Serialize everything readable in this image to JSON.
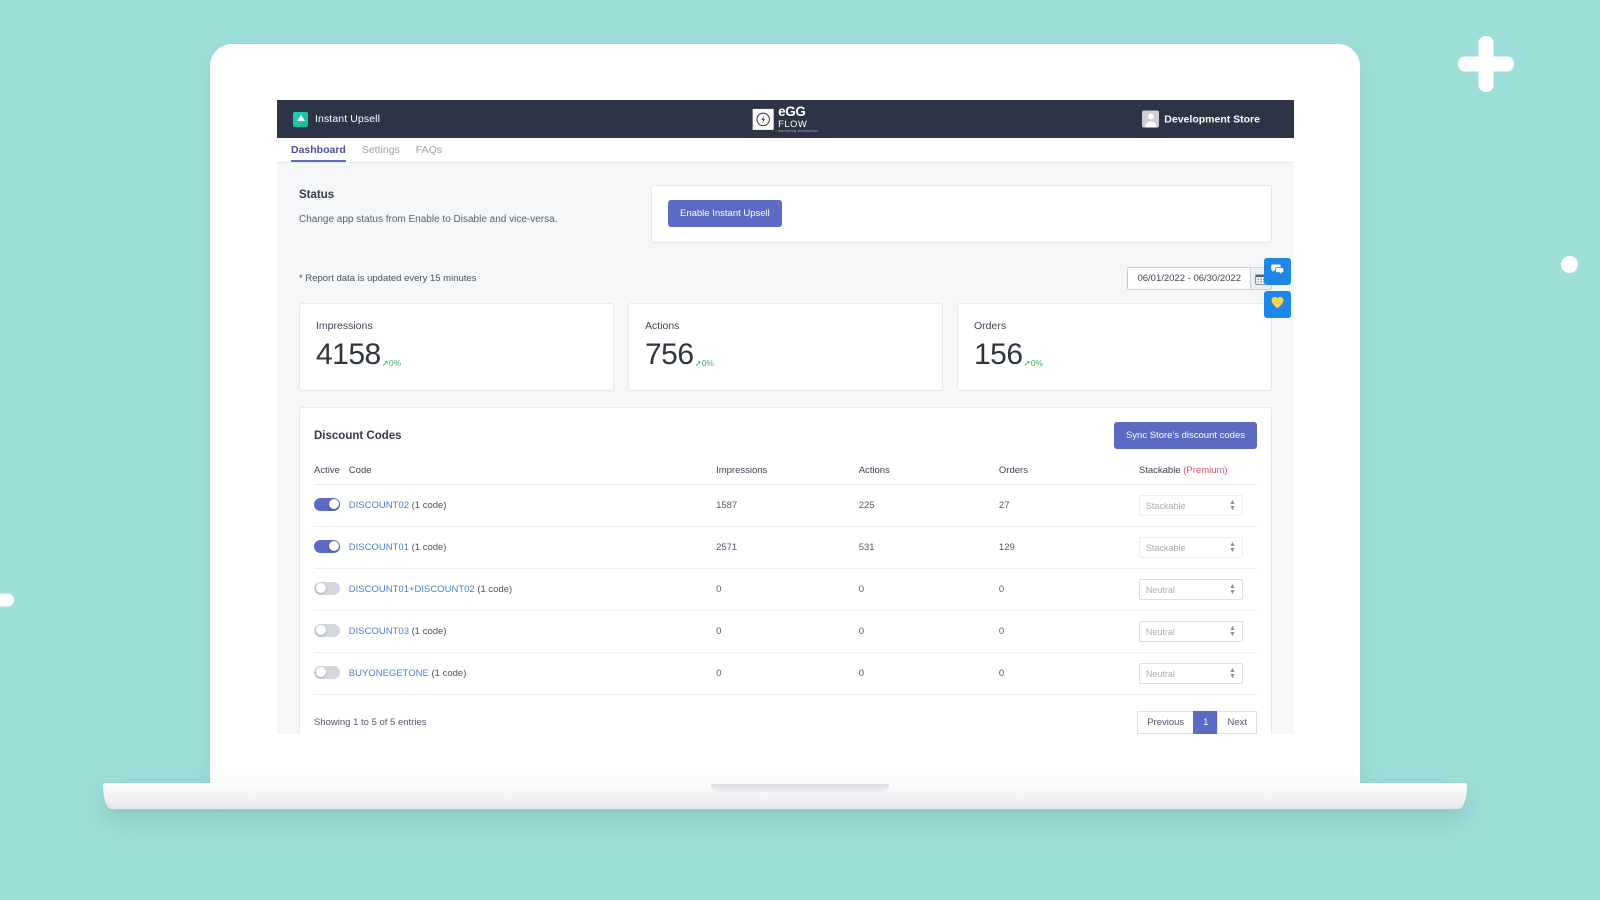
{
  "theme": {
    "background": "#9fdfda",
    "topbar_bg": "#2c3445",
    "accent": "#5c6ac4",
    "link": "#4a7fd4",
    "positive": "#3fae5d",
    "premium": "#e0536b",
    "fab": "#1f87e8"
  },
  "topbar": {
    "app_name": "Instant Upsell",
    "logo": {
      "line1": "eGG",
      "line2": "FLOW",
      "line3": "marketing automation"
    },
    "store_name": "Development Store"
  },
  "nav": {
    "tabs": [
      {
        "label": "Dashboard",
        "active": true
      },
      {
        "label": "Settings",
        "active": false
      },
      {
        "label": "FAQs",
        "active": false
      }
    ]
  },
  "status": {
    "title": "Status",
    "description": "Change app status from Enable to Disable and vice-versa.",
    "button_label": "Enable Instant Upsell"
  },
  "report": {
    "note": "* Report data is updated every 15 minutes",
    "date_range": "06/01/2022 - 06/30/2022",
    "calendar_icon": "calendar-icon"
  },
  "metrics": [
    {
      "label": "Impressions",
      "value": "4158",
      "delta": "0%",
      "direction": "up"
    },
    {
      "label": "Actions",
      "value": "756",
      "delta": "0%",
      "direction": "up"
    },
    {
      "label": "Orders",
      "value": "156",
      "delta": "0%",
      "direction": "up"
    }
  ],
  "discount_codes": {
    "title": "Discount Codes",
    "sync_button": "Sync Store's discount codes",
    "columns": {
      "active": "Active",
      "code": "Code",
      "impressions": "Impressions",
      "actions": "Actions",
      "orders": "Orders",
      "stackable": "Stackable",
      "stackable_badge": "(Premium)"
    },
    "rows": [
      {
        "active": true,
        "code": "DISCOUNT02",
        "code_suffix": "(1 code)",
        "impressions": "1587",
        "actions": "225",
        "orders": "27",
        "stackable": "Stackable",
        "stackable_muted": true
      },
      {
        "active": true,
        "code": "DISCOUNT01",
        "code_suffix": "(1 code)",
        "impressions": "2571",
        "actions": "531",
        "orders": "129",
        "stackable": "Stackable",
        "stackable_muted": true
      },
      {
        "active": false,
        "code": "DISCOUNT01+DISCOUNT02",
        "code_suffix": "(1 code)",
        "impressions": "0",
        "actions": "0",
        "orders": "0",
        "stackable": "Neutral",
        "stackable_muted": false
      },
      {
        "active": false,
        "code": "DISCOUNT03",
        "code_suffix": "(1 code)",
        "impressions": "0",
        "actions": "0",
        "orders": "0",
        "stackable": "Neutral",
        "stackable_muted": false
      },
      {
        "active": false,
        "code": "BUYONEGETONE",
        "code_suffix": "(1 code)",
        "impressions": "0",
        "actions": "0",
        "orders": "0",
        "stackable": "Neutral",
        "stackable_muted": false
      }
    ],
    "entries_info": "Showing 1 to 5 of 5 entries",
    "pagination": {
      "previous": "Previous",
      "current": "1",
      "next": "Next"
    }
  },
  "floating_widgets": [
    {
      "name": "chat-icon"
    },
    {
      "name": "heart-icon"
    }
  ]
}
